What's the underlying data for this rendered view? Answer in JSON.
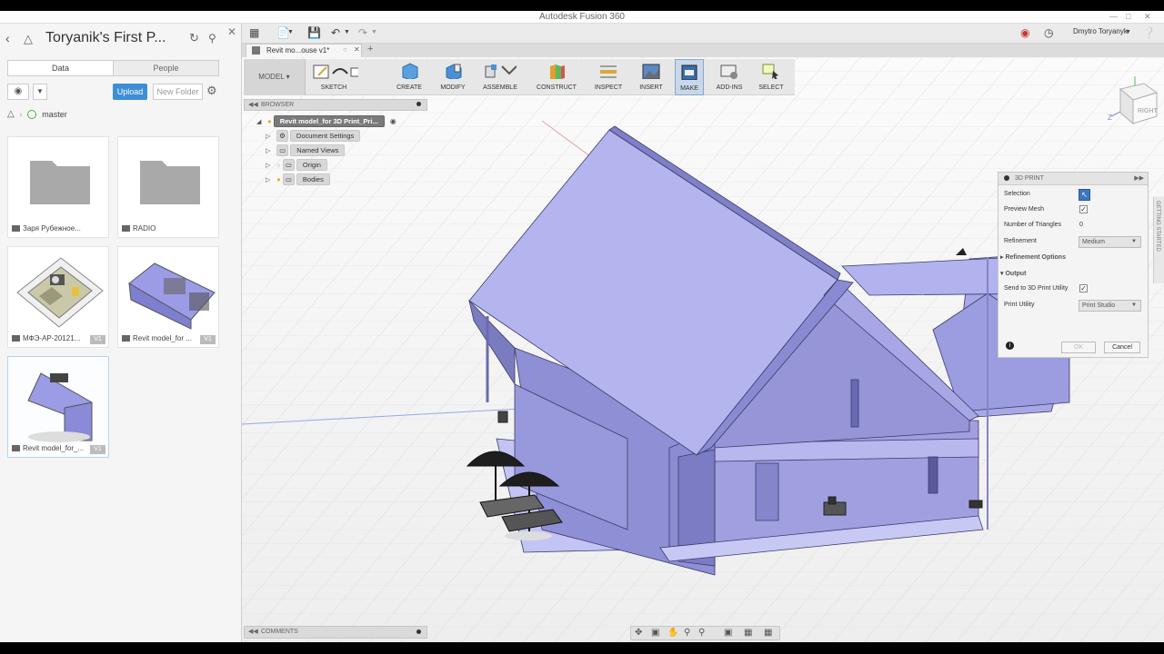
{
  "window": {
    "title": "Autodesk Fusion 360"
  },
  "data_panel": {
    "project_title": "Toryanik's First P...",
    "tabs": [
      "Data",
      "People"
    ],
    "upload_label": "Upload",
    "new_folder_label": "New Folder",
    "branch": "master",
    "items": [
      {
        "label": "Заря Рубежное...",
        "kind": "folder",
        "version": ""
      },
      {
        "label": "RADIO",
        "kind": "folder",
        "version": ""
      },
      {
        "label": "МФЭ-АР-20121...",
        "kind": "design",
        "version": "V1"
      },
      {
        "label": "Revit model_for ...",
        "kind": "design",
        "version": "V1"
      },
      {
        "label": "Revit model_for_...",
        "kind": "design",
        "version": "V1"
      }
    ]
  },
  "document_tab": {
    "label": "Revit mo...ouse v1*"
  },
  "user": {
    "name": "Dmytro Toryanyk"
  },
  "toolbar": {
    "mode": "MODEL",
    "tools": [
      "SKETCH",
      "CREATE",
      "MODIFY",
      "ASSEMBLE",
      "CONSTRUCT",
      "INSPECT",
      "INSERT",
      "MAKE",
      "ADD-INS",
      "SELECT"
    ]
  },
  "browser": {
    "header": "BROWSER",
    "root": "Revit model_for 3D Print_Pri...",
    "nodes": [
      "Document Settings",
      "Named Views",
      "Origin",
      "Bodies"
    ]
  },
  "print_panel": {
    "title": "3D PRINT",
    "selection_label": "Selection",
    "preview_mesh_label": "Preview Mesh",
    "triangles_label": "Number of Triangles",
    "triangles_value": "0",
    "refinement_label": "Refinement",
    "refinement_value": "Medium",
    "refinement_options_label": "Refinement Options",
    "output_label": "Output",
    "send_label": "Send to 3D Print Utility",
    "utility_label": "Print Utility",
    "utility_value": "Print Studio",
    "ok_label": "OK",
    "cancel_label": "Cancel",
    "preview_mesh_checked": true,
    "send_checked": true
  },
  "getting_started": "GETTING STARTED",
  "comments": {
    "label": "COMMENTS"
  },
  "viewcube": {
    "face": "RIGHT",
    "axis_z": "Z"
  }
}
